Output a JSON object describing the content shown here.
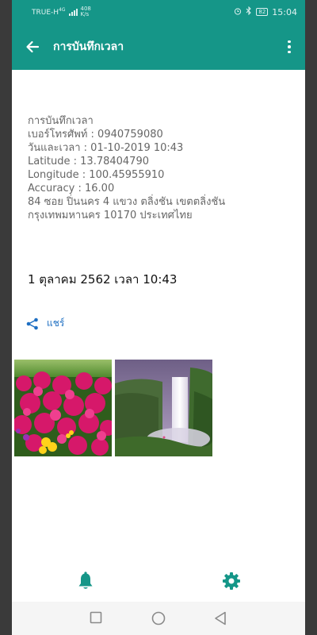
{
  "status_bar": {
    "carrier": "TRUE-H",
    "carrier_badge": "4G",
    "speed_value": "408",
    "speed_unit": "K/s",
    "battery": "82",
    "time": "15:04"
  },
  "appbar": {
    "title": "การบันทึกเวลา"
  },
  "record": {
    "heading": "การบันทึกเวลา",
    "phone": "เบอร์โทรศัพท์ : 0940759080",
    "datetime": "วันและเวลา : 01-10-2019 10:43",
    "latitude": "Latitude  : 13.78404790",
    "longitude": "Longitude : 100.45955910",
    "accuracy": "Accuracy  : 16.00",
    "address_line1": "84 ซอย ปิ่นนคร 4 แขวง ตลิ่งชัน เขตตลิ่งชัน",
    "address_line2": "กรุงเทพมหานคร 10170 ประเทศไทย"
  },
  "date_display": "1 ตุลาคม 2562 เวลา 10:43",
  "share_label": "แชร์",
  "colors": {
    "primary": "#159688",
    "link": "#1e6fc2",
    "text_muted": "#666666"
  },
  "icons": {
    "back": "arrow-back-icon",
    "more": "more-vert-icon",
    "share": "share-icon",
    "bell": "bell-icon",
    "settings": "gear-icon"
  }
}
